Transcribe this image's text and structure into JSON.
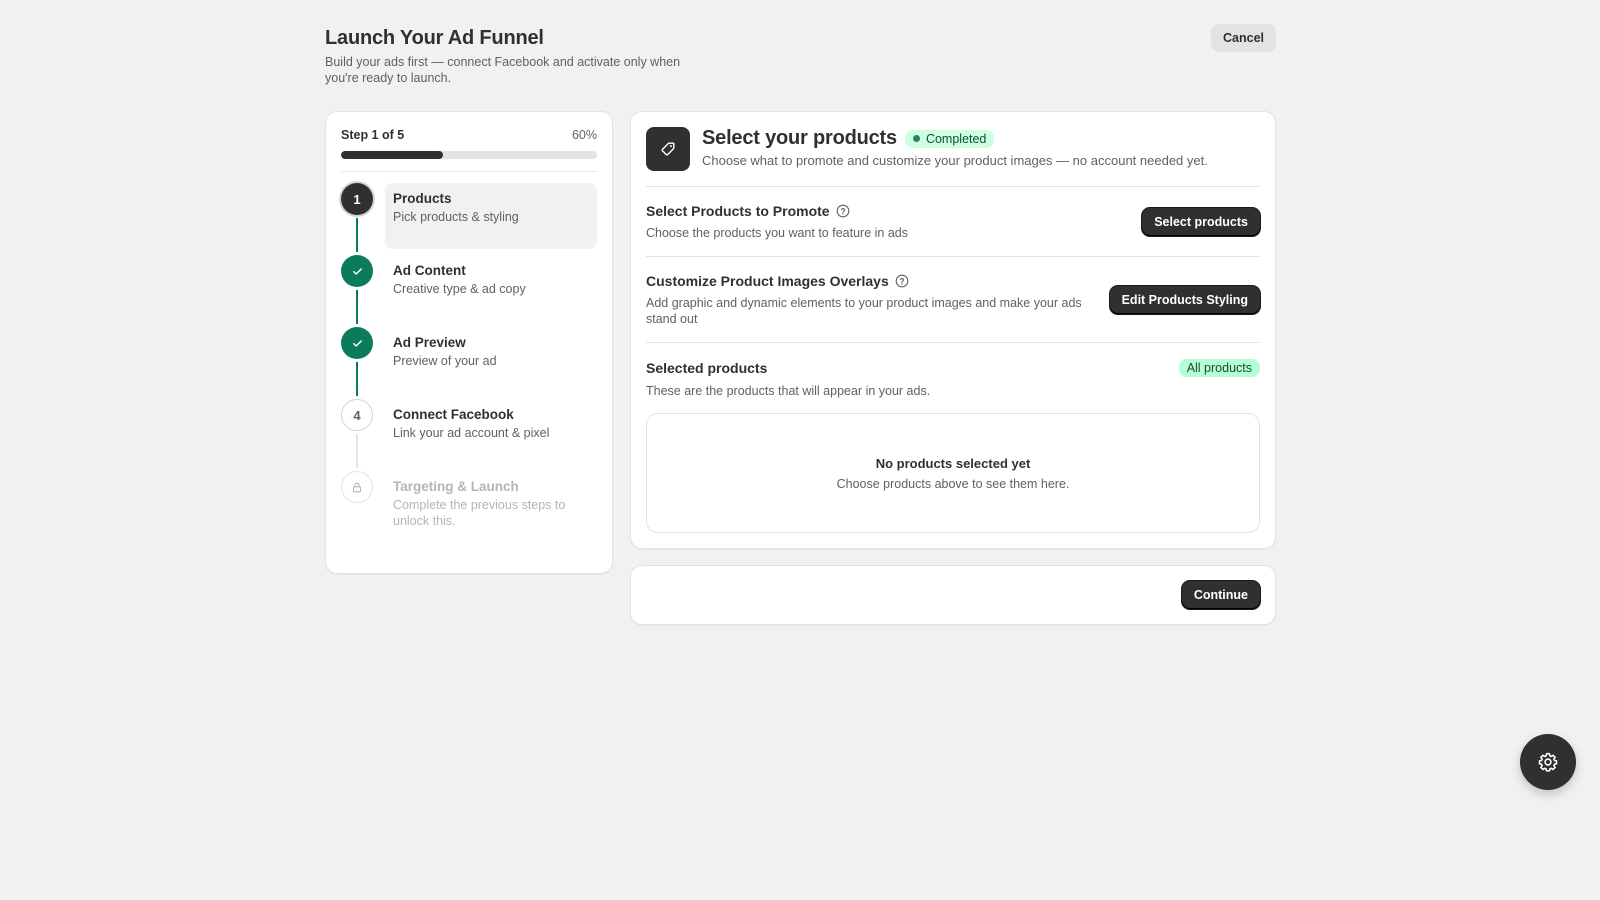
{
  "header": {
    "title": "Launch Your Ad Funnel",
    "subtitle": "Build your ads first — connect Facebook and activate only when you're ready to launch.",
    "cancel_label": "Cancel"
  },
  "progress": {
    "label": "Step 1 of 5",
    "percent_label": "60%",
    "percent": 0.4
  },
  "steps": [
    {
      "marker": "1",
      "status": "active",
      "title": "Products",
      "desc": "Pick products & styling"
    },
    {
      "marker": "check-icon",
      "status": "done",
      "title": "Ad Content",
      "desc": "Creative type & ad copy"
    },
    {
      "marker": "check-icon",
      "status": "done",
      "title": "Ad Preview",
      "desc": "Preview of your ad"
    },
    {
      "marker": "4",
      "status": "todo",
      "title": "Connect Facebook",
      "desc": "Link your ad account & pixel"
    },
    {
      "marker": "lock-icon",
      "status": "locked",
      "title": "Targeting & Launch",
      "desc": "Complete the previous steps to unlock this."
    }
  ],
  "main": {
    "icon": "tag-icon",
    "title": "Select your products",
    "status_badge": "Completed",
    "description": "Choose what to promote and customize your product images — no account needed yet.",
    "sections": {
      "select_products": {
        "title": "Select Products to Promote",
        "desc": "Choose the products you want to feature in ads",
        "button": "Select products"
      },
      "customize": {
        "title": "Customize Product Images Overlays",
        "desc": "Add graphic and dynamic elements to your product images and make your ads stand out",
        "button": "Edit Products Styling"
      },
      "selected": {
        "title": "Selected products",
        "badge": "All products",
        "desc": "These are the products that will appear in your ads.",
        "empty_title": "No products selected yet",
        "empty_desc": "Choose products above to see them here."
      }
    }
  },
  "footer": {
    "continue_label": "Continue"
  },
  "fab_icon": "settings-icon",
  "colors": {
    "background": "#f1f1f1",
    "dark": "#303030",
    "done_green": "#0a7c5c",
    "success_badge": "#cdfee1",
    "all_products_badge": "#b4fed2"
  }
}
